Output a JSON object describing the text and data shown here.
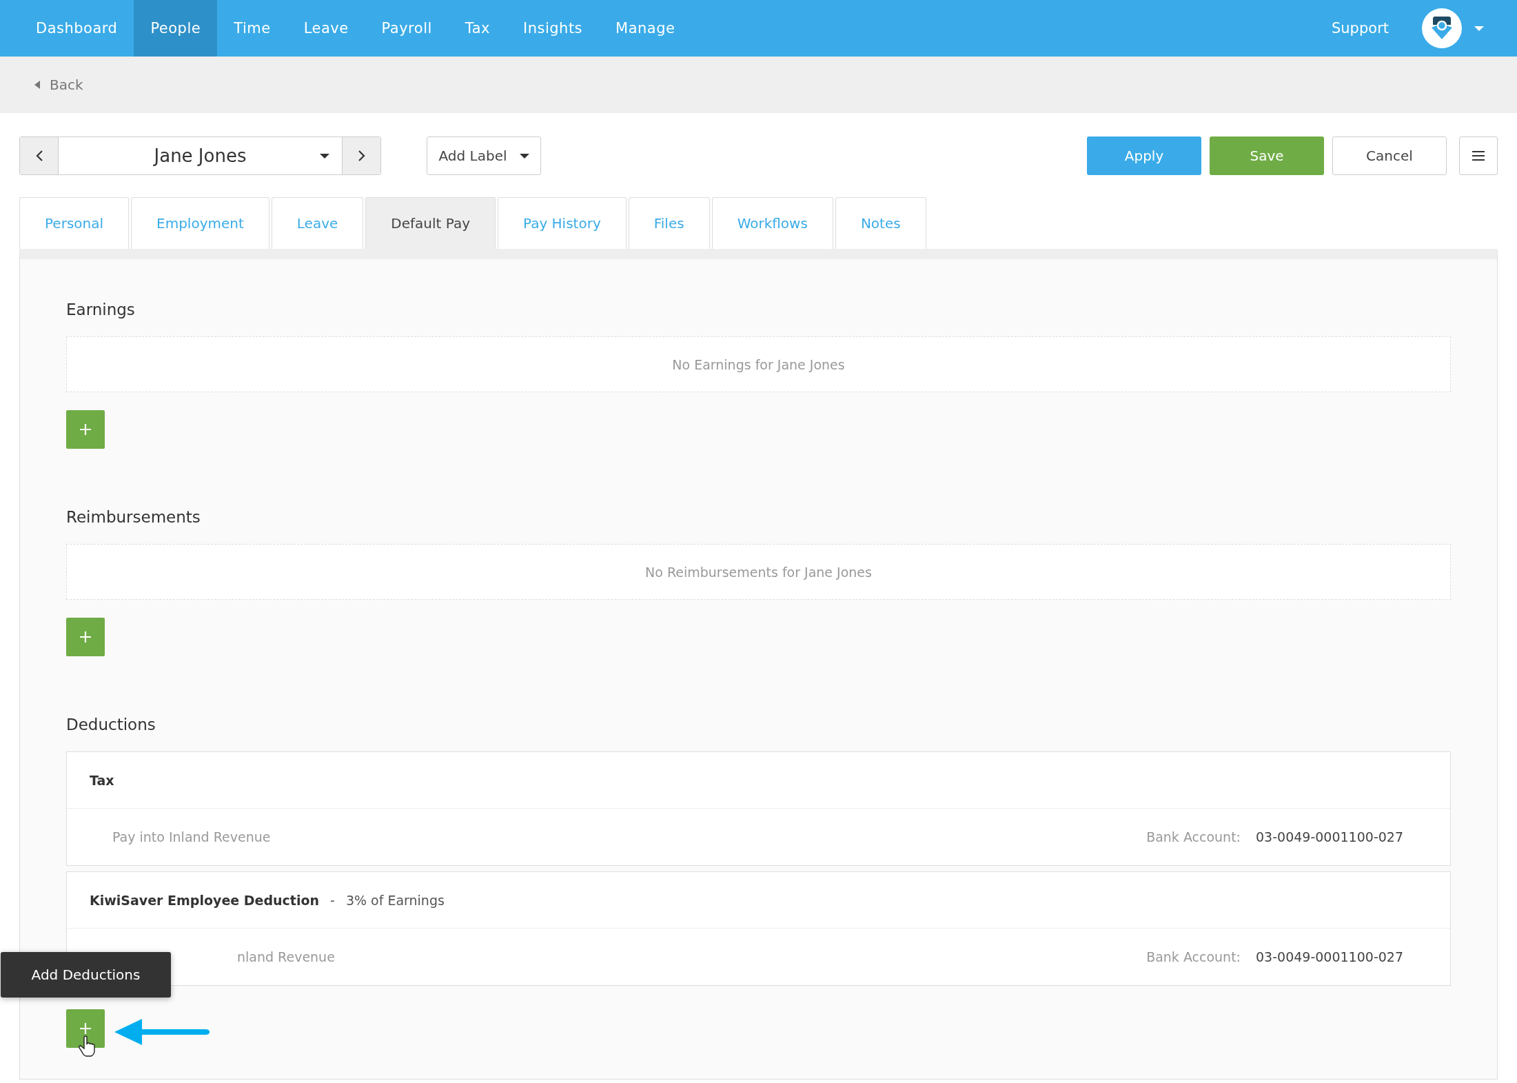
{
  "nav": {
    "items": [
      {
        "label": "Dashboard",
        "selected": false
      },
      {
        "label": "People",
        "selected": true
      },
      {
        "label": "Time",
        "selected": false
      },
      {
        "label": "Leave",
        "selected": false
      },
      {
        "label": "Payroll",
        "selected": false
      },
      {
        "label": "Tax",
        "selected": false
      },
      {
        "label": "Insights",
        "selected": false
      },
      {
        "label": "Manage",
        "selected": false
      }
    ],
    "support": "Support"
  },
  "back": "Back",
  "employee": {
    "name": "Jane Jones"
  },
  "add_label": "Add Label",
  "actions": [
    {
      "label": "Apply",
      "kind": "primary"
    },
    {
      "label": "Save",
      "kind": "success"
    },
    {
      "label": "Cancel",
      "kind": "plain"
    }
  ],
  "tabs": [
    {
      "label": "Personal",
      "selected": false
    },
    {
      "label": "Employment",
      "selected": false
    },
    {
      "label": "Leave",
      "selected": false
    },
    {
      "label": "Default Pay",
      "selected": true
    },
    {
      "label": "Pay History",
      "selected": false
    },
    {
      "label": "Files",
      "selected": false
    },
    {
      "label": "Workflows",
      "selected": false
    },
    {
      "label": "Notes",
      "selected": false
    }
  ],
  "sections": [
    {
      "title": "Earnings",
      "empty_text": "No Earnings for Jane Jones"
    },
    {
      "title": "Reimbursements",
      "empty_text": "No Reimbursements for Jane Jones"
    },
    {
      "title": "Deductions",
      "items": [
        {
          "name": "Tax",
          "payment": "Pay into Inland Revenue",
          "payment_covered": false,
          "bank_label": "Bank Account:",
          "bank_account": "03-0049-0001100-027"
        },
        {
          "name": "KiwiSaver Employee Deduction",
          "separator": "-",
          "detail": "3% of Earnings",
          "payment": "nland Revenue",
          "payment_covered": true,
          "bank_label": "Bank Account:",
          "bank_account": "03-0049-0001100-027"
        }
      ],
      "tooltip": "Add Deductions"
    }
  ]
}
